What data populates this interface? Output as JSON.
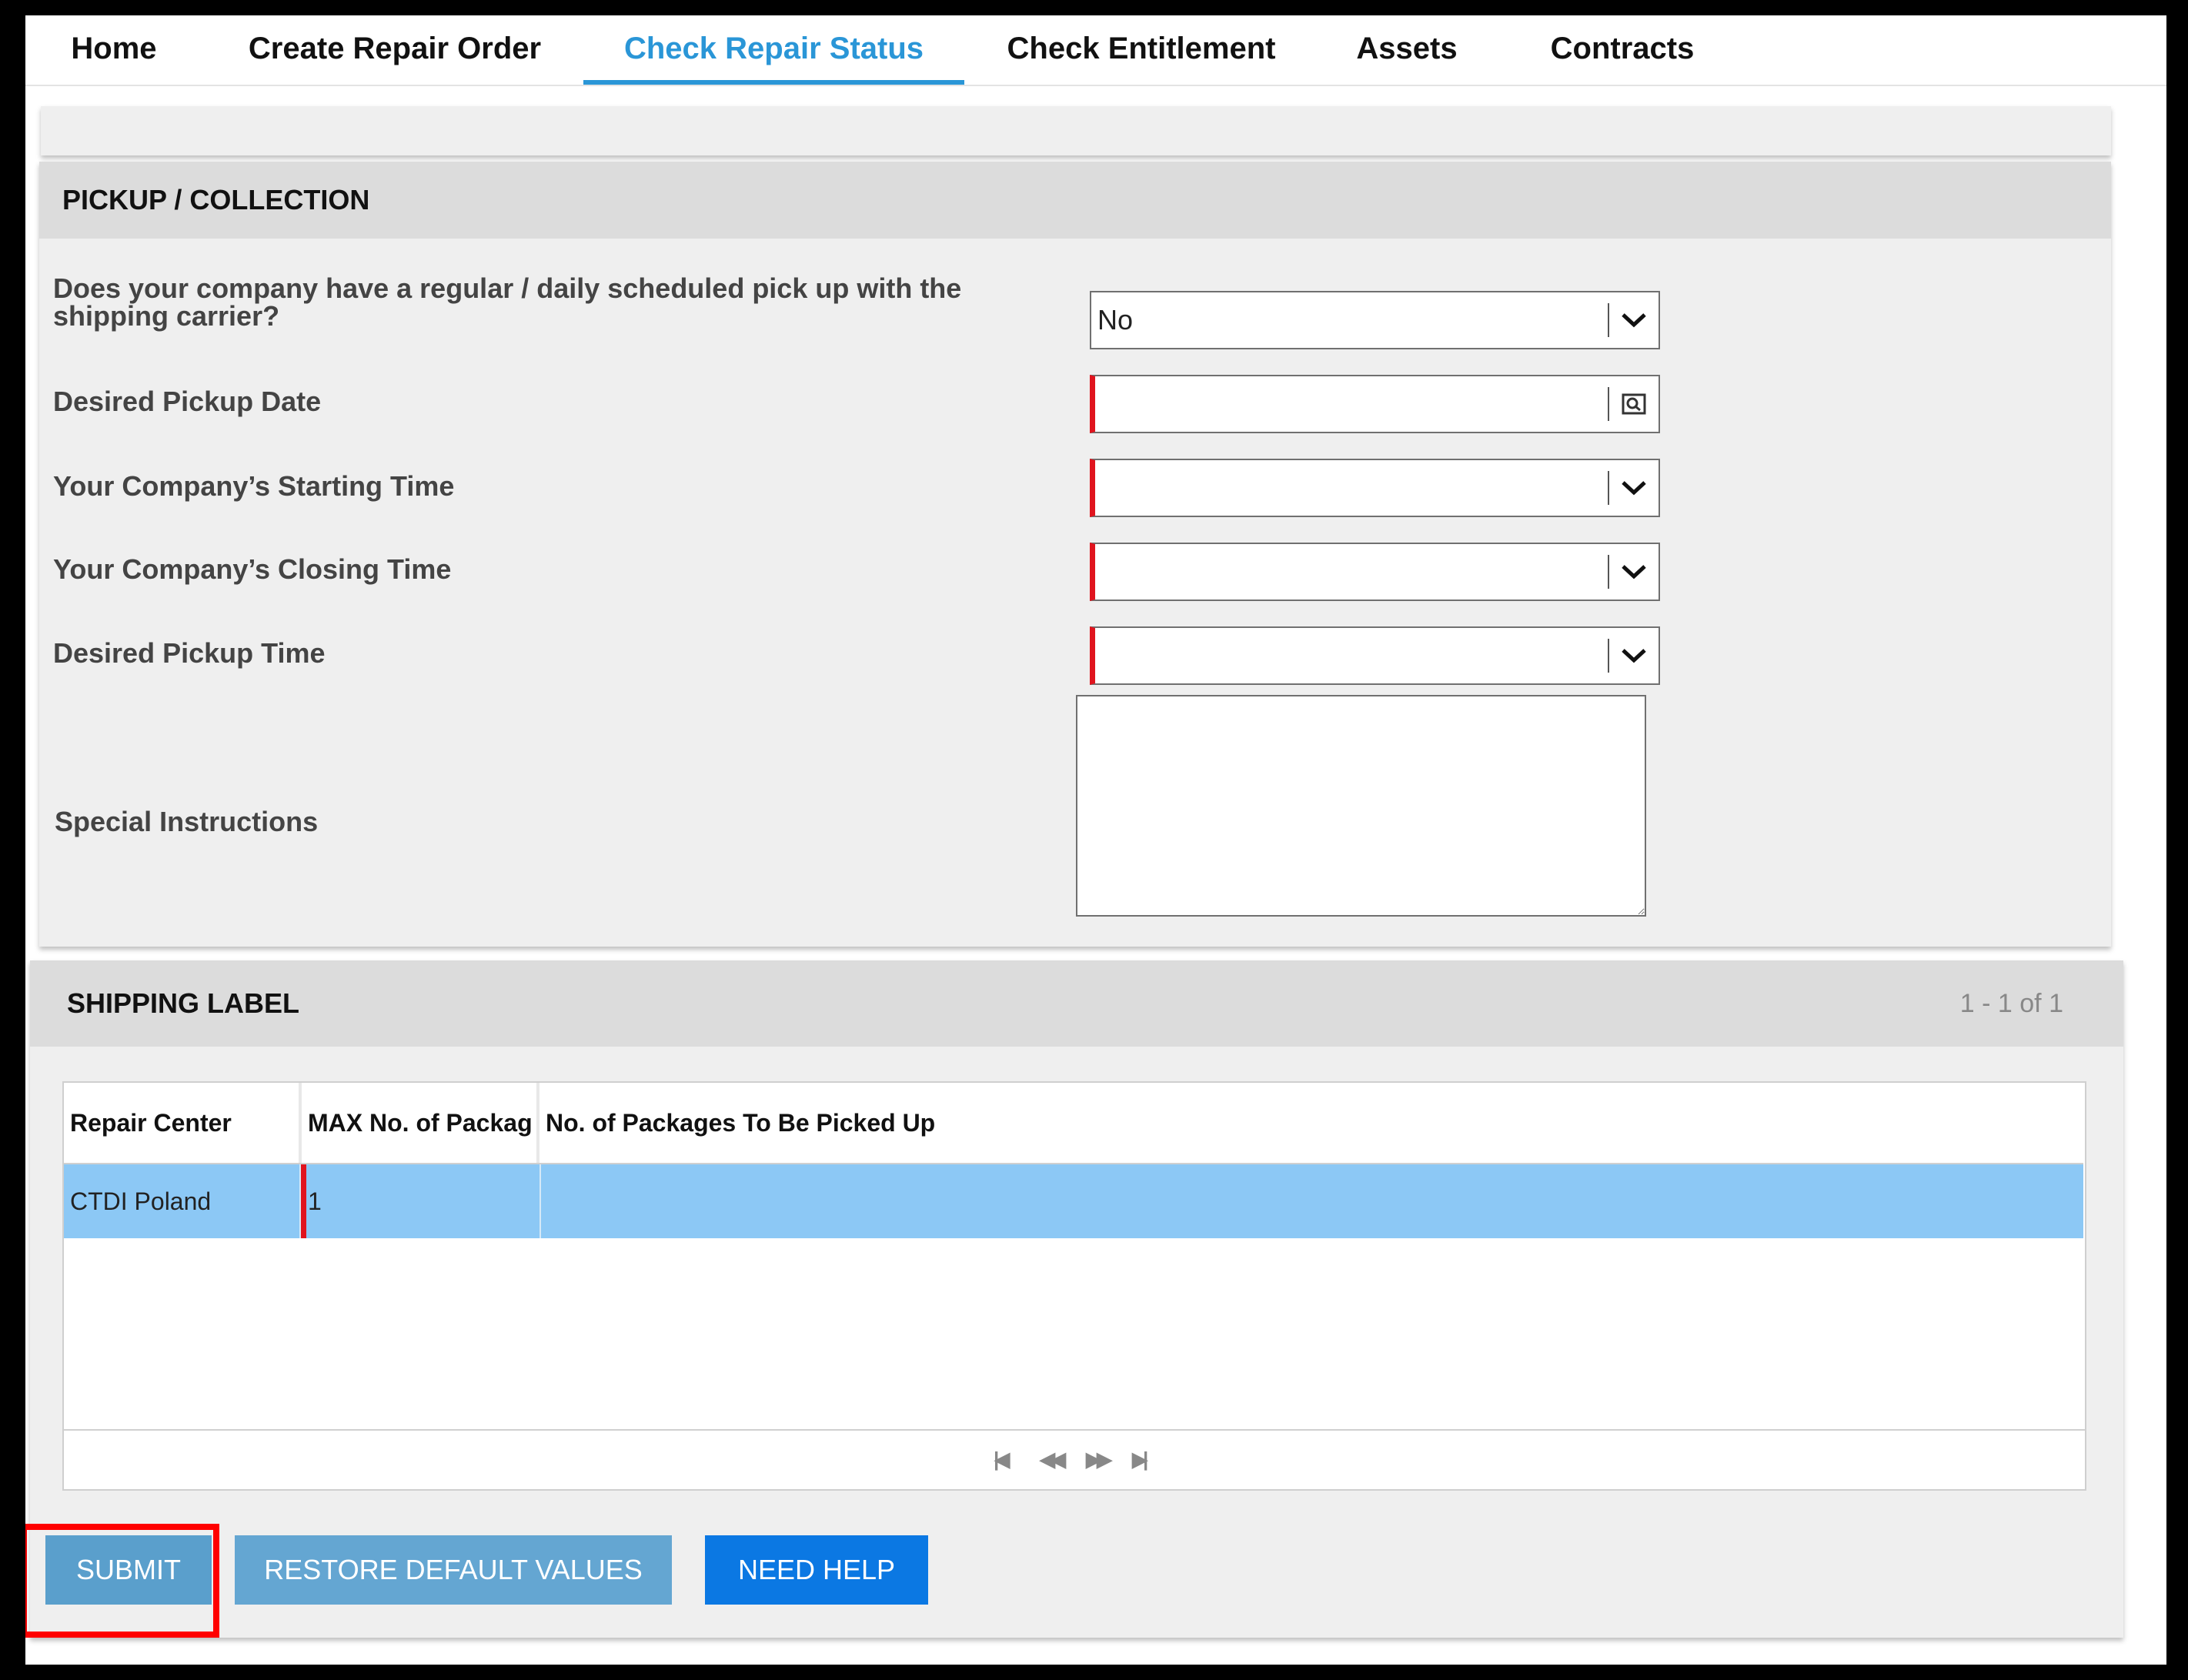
{
  "nav": {
    "tabs": [
      {
        "label": "Home"
      },
      {
        "label": "Create Repair Order"
      },
      {
        "label": "Check Repair Status",
        "active": true
      },
      {
        "label": "Check Entitlement"
      },
      {
        "label": "Assets"
      },
      {
        "label": "Contracts"
      }
    ]
  },
  "pickup": {
    "title": "PICKUP / COLLECTION",
    "regular_pickup_label_line1": "Does your company have a regular / daily scheduled pick up with the",
    "regular_pickup_label_line2": "shipping carrier?",
    "regular_pickup_value": "No",
    "pickup_date_label": "Desired Pickup Date",
    "pickup_date_value": "",
    "start_time_label": "Your Company’s Starting Time",
    "start_time_value": "",
    "closing_time_label": "Your Company’s Closing Time",
    "closing_time_value": "",
    "pickup_time_label": "Desired Pickup Time",
    "pickup_time_value": "",
    "special_instructions_label": "Special Instructions",
    "special_instructions_value": ""
  },
  "shipping": {
    "title": "SHIPPING LABEL",
    "count": "1 - 1 of 1",
    "columns": [
      "Repair Center",
      "MAX No. of Packag",
      "No. of Packages To Be Picked Up"
    ],
    "rows": [
      {
        "repair_center": "CTDI Poland",
        "max_packages": "1",
        "packages_to_pickup": ""
      }
    ]
  },
  "actions": {
    "submit": "SUBMIT",
    "restore": "RESTORE DEFAULT VALUES",
    "help": "NEED HELP"
  },
  "colors": {
    "accent": "#2a96d7",
    "required": "#e0141e",
    "selected_row": "#8cc8f5",
    "submit_bg": "#5a9fcc",
    "help_bg": "#0b78e3",
    "highlight": "#ff0000"
  }
}
